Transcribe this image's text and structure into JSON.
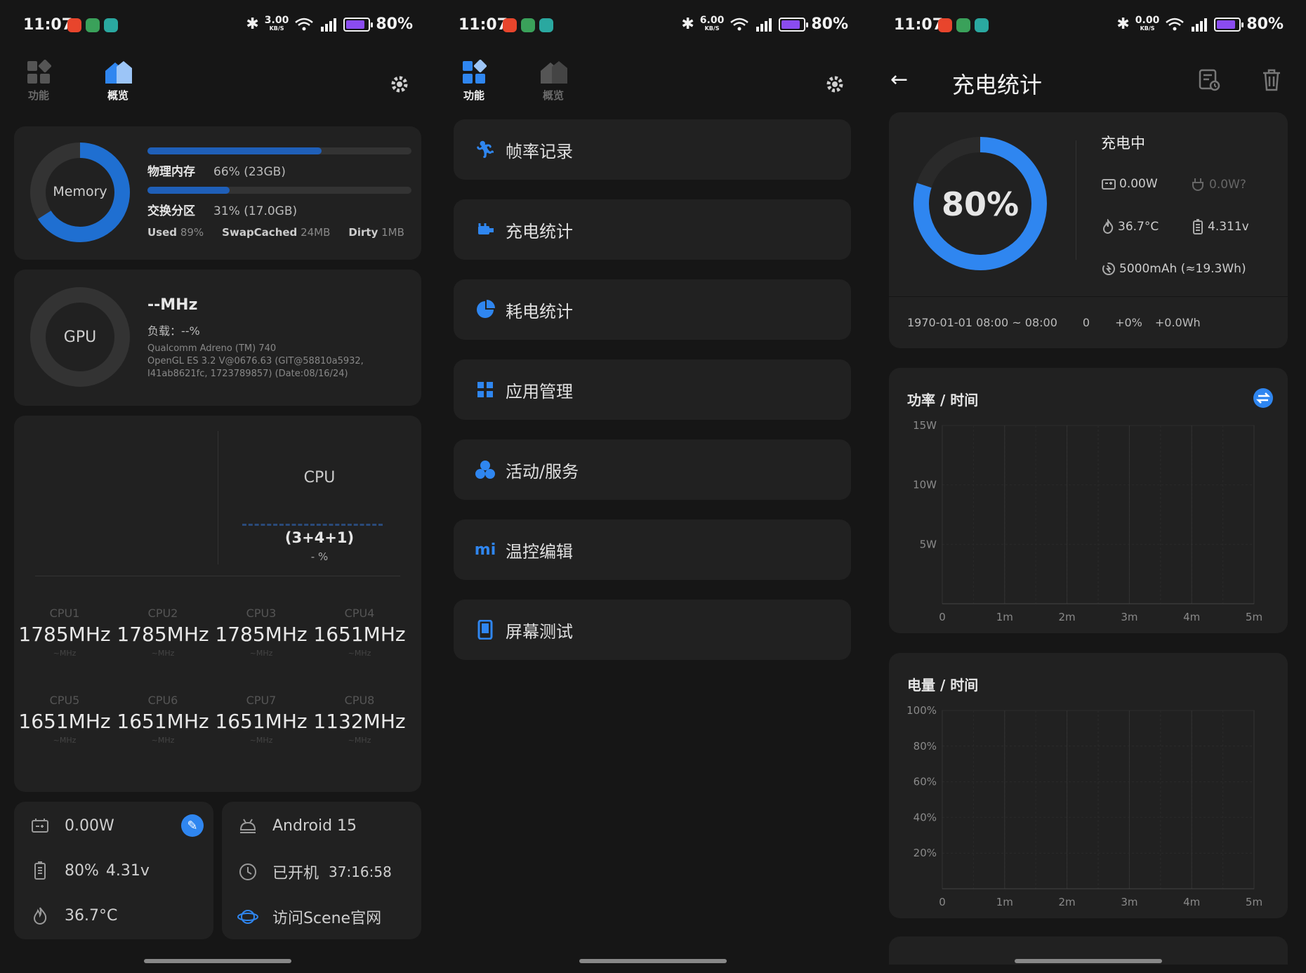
{
  "status_bar": {
    "s1": {
      "time": "11:07",
      "speed": "3.00",
      "speed_unit": "KB/S",
      "battery": "80%"
    },
    "s2": {
      "time": "11:07",
      "speed": "6.00",
      "speed_unit": "KB/S",
      "battery": "80%"
    },
    "s3": {
      "time": "11:07",
      "speed": "0.00",
      "speed_unit": "KB/S",
      "battery": "80%"
    }
  },
  "tabs": {
    "features": "功能",
    "overview": "概览"
  },
  "overview": {
    "memory": {
      "ring_label": "Memory",
      "physical_label": "物理内存",
      "physical_value": "66% (23GB)",
      "physical_fraction": 0.66,
      "swap_label": "交换分区",
      "swap_value": "31% (17.0GB)",
      "swap_fraction": 0.31,
      "used_label": "Used",
      "used_value": "89%",
      "used_fraction": 0.89,
      "swapcached_label": "SwapCached",
      "swapcached_value": "24MB",
      "dirty_label": "Dirty",
      "dirty_value": "1MB"
    },
    "gpu": {
      "ring_label": "GPU",
      "freq": "--MHz",
      "load": "负载：--%",
      "renderer": "Qualcomm Adreno (TM) 740",
      "version": "OpenGL ES 3.2 V@0676.63 (GIT@58810a5932,",
      "version2": "I41ab8621fc, 1723789857) (Date:08/16/24)"
    },
    "cpu": {
      "label": "CPU",
      "cluster": "(3+4+1)",
      "load": "- %",
      "cores": [
        {
          "name": "CPU1",
          "freq": "1785MHz",
          "sub": "~MHz"
        },
        {
          "name": "CPU2",
          "freq": "1785MHz",
          "sub": "~MHz"
        },
        {
          "name": "CPU3",
          "freq": "1785MHz",
          "sub": "~MHz"
        },
        {
          "name": "CPU4",
          "freq": "1651MHz",
          "sub": "~MHz"
        },
        {
          "name": "CPU5",
          "freq": "1651MHz",
          "sub": "~MHz"
        },
        {
          "name": "CPU6",
          "freq": "1651MHz",
          "sub": "~MHz"
        },
        {
          "name": "CPU7",
          "freq": "1651MHz",
          "sub": "~MHz"
        },
        {
          "name": "CPU8",
          "freq": "1132MHz",
          "sub": "~MHz"
        }
      ]
    },
    "power": {
      "watts": "0.00W",
      "battery": "80%",
      "voltage": "4.31v",
      "temp": "36.7°C"
    },
    "system": {
      "android": "Android 15",
      "uptime_label": "已开机",
      "uptime": "37:16:58",
      "website": "访问Scene官网"
    }
  },
  "features": {
    "items": [
      "帧率记录",
      "充电统计",
      "耗电统计",
      "应用管理",
      "活动/服务",
      "温控编辑",
      "屏幕测试"
    ]
  },
  "charging": {
    "title": "充电统计",
    "percent": "80%",
    "percent_value": 0.8,
    "status": "充电中",
    "power_in": "0.00W",
    "power_est": "0.0W?",
    "temp": "36.7°C",
    "voltage": "4.311v",
    "capacity": "5000mAh (≈19.3Wh)",
    "session_range": "1970-01-01 08:00 ~ 08:00",
    "session_count": "0",
    "session_percent": "+0%",
    "session_energy": "+0.0Wh",
    "chart_power_title": "功率 / 时间",
    "chart_level_title": "电量 / 时间"
  },
  "chart_data": [
    {
      "type": "line",
      "title": "功率 / 时间",
      "y_ticks": [
        "15W",
        "10W",
        "5W"
      ],
      "x_ticks": [
        "0",
        "1m",
        "2m",
        "3m",
        "4m",
        "5m"
      ],
      "ylim": [
        0,
        15
      ],
      "series": []
    },
    {
      "type": "line",
      "title": "电量 / 时间",
      "y_ticks": [
        "100%",
        "80%",
        "60%",
        "40%",
        "20%"
      ],
      "x_ticks": [
        "0",
        "1m",
        "2m",
        "3m",
        "4m",
        "5m"
      ],
      "ylim": [
        0,
        100
      ],
      "series": []
    }
  ],
  "colors": {
    "accent": "#2f86f0",
    "card": "#212121",
    "bg": "#161616"
  }
}
